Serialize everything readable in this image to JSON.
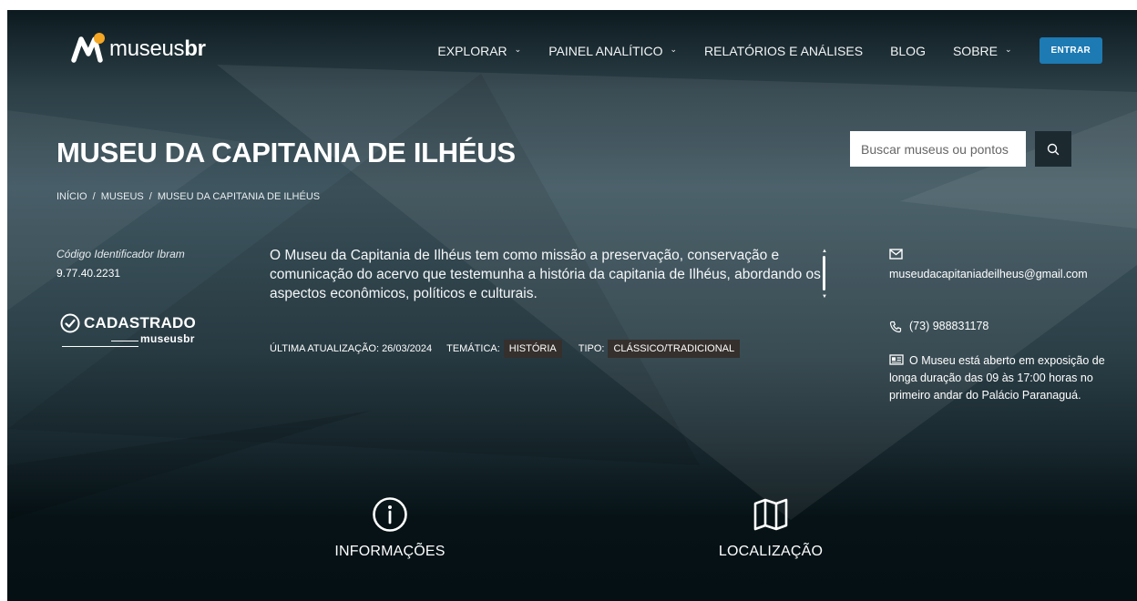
{
  "header": {
    "logo": {
      "text_light": "museus",
      "text_bold": "br"
    },
    "nav": [
      {
        "label": "EXPLORAR",
        "has_dropdown": true
      },
      {
        "label": "PAINEL ANALÍTICO",
        "has_dropdown": true
      },
      {
        "label": "RELATÓRIOS E ANÁLISES",
        "has_dropdown": false
      },
      {
        "label": "BLOG",
        "has_dropdown": false
      },
      {
        "label": "SOBRE",
        "has_dropdown": true
      }
    ],
    "login_label": "ENTRAR"
  },
  "page": {
    "title": "MUSEU DA CAPITANIA DE ILHÉUS",
    "breadcrumb": [
      "INÍCIO",
      "MUSEUS",
      "MUSEU DA CAPITANIA DE ILHÉUS"
    ]
  },
  "search": {
    "placeholder": "Buscar museus ou pontos"
  },
  "museum": {
    "id_label": "Código Identificador Ibram",
    "id_value": "9.77.40.2231",
    "badge_word": "CADASTRADO",
    "badge_sub": "museusbr",
    "description": "O Museu da Capitania de Ilhéus tem como missão a preservação, conservação e comunicação do acervo que testemunha a história da capitania de Ilhéus, abordando os aspectos econômicos, políticos e culturais.",
    "last_update": "ÚLTIMA ATUALIZAÇÃO: 26/03/2024",
    "theme_label": "TEMÁTICA:",
    "theme_value": "HISTÓRIA",
    "type_label": "TIPO:",
    "type_value": "CLÁSSICO/TRADICIONAL"
  },
  "contact": {
    "email": "museudacapitaniadeilheus@gmail.com",
    "phone": "(73) 988831178",
    "hours": "O Museu está aberto em exposição de longa duração das 09 às 17:00 horas no primeiro andar do Palácio Paranaguá."
  },
  "tabs": [
    {
      "label": "INFORMAÇÕES",
      "icon": "info-icon"
    },
    {
      "label": "LOCALIZAÇÃO",
      "icon": "map-icon"
    }
  ],
  "colors": {
    "accent": "#1d7ab3",
    "logo_dot": "#f5a623",
    "tag_bg": "#35302d"
  }
}
